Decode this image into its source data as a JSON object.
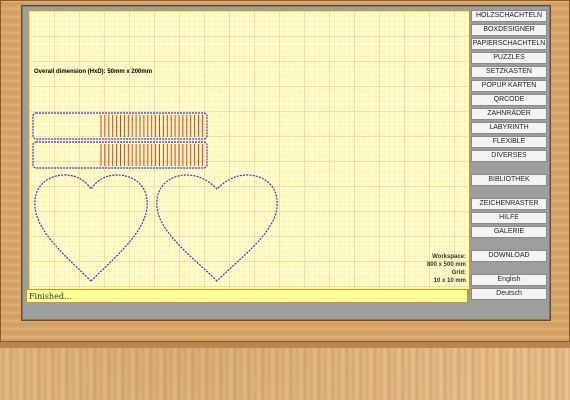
{
  "canvas": {
    "dimension_text": "Overall dimension (HxD): 50mm x 200mm",
    "workspace_label": "Workspace:",
    "workspace_size": "800 x 500 mm",
    "grid_label": "Grid:",
    "grid_size": "10 x 10 mm"
  },
  "status": {
    "text": "Finished..."
  },
  "menu": {
    "items": [
      "HOLZSCHACHTELN",
      "BOXDESIGNER",
      "PAPIERSCHACHTELN",
      "PUZZLES",
      "SETZKASTEN",
      "POPUP KARTEN",
      "QRCODE",
      "ZAHNRÄDER",
      "LABYRINTH",
      "FLEXIBLE",
      "DIVERSES"
    ],
    "library": "BIBLIOTHEK",
    "tools": [
      "ZEICHENRASTER",
      "HILFE",
      "GALERIE"
    ],
    "download": "DOWNLOAD",
    "languages": [
      "English",
      "Deutsch"
    ]
  },
  "colors": {
    "canvas_bg": "#ffffc4",
    "outline": "#3333cc",
    "slots": "#e03a1a",
    "status_bg": "#ffff99"
  }
}
